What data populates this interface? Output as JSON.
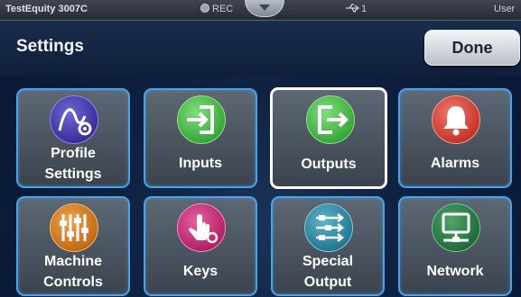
{
  "status_bar": {
    "device_name": "TestEquity 3007C",
    "rec_label": "REC",
    "usb_count": "1",
    "user_label": "User"
  },
  "header": {
    "title": "Settings",
    "done_label": "Done"
  },
  "tiles": [
    {
      "label_line1": "Profile",
      "label_line2": "Settings",
      "icon": "profile-settings-icon",
      "color": "#3a2f9c"
    },
    {
      "label": "Inputs",
      "icon": "inputs-icon",
      "color": "#3aa83a"
    },
    {
      "label": "Outputs",
      "icon": "outputs-icon",
      "color": "#3aa83a",
      "selected": true
    },
    {
      "label": "Alarms",
      "icon": "alarm-bell-icon",
      "color": "#c8352a"
    },
    {
      "label_line1": "Machine",
      "label_line2": "Controls",
      "icon": "machine-controls-icon",
      "color": "#c46c17"
    },
    {
      "label": "Keys",
      "icon": "keys-icon",
      "color": "#b52268"
    },
    {
      "label_line1": "Special",
      "label_line2": "Output",
      "icon": "special-output-icon",
      "color": "#257a93"
    },
    {
      "label": "Network",
      "icon": "network-icon",
      "color": "#1f6d3a"
    }
  ],
  "colors": {
    "tile_border": "#4aa3e6",
    "selected_border": "#ffffff",
    "header_bg": "#1a2d4c"
  }
}
